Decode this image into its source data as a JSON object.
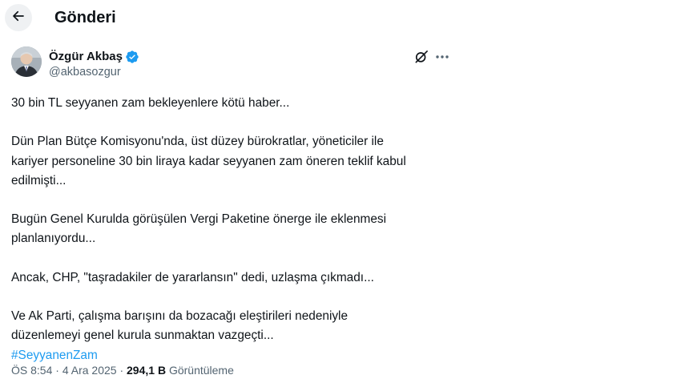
{
  "header": {
    "back_icon": "arrow-left-icon",
    "title": "Gönderi"
  },
  "author": {
    "name": "Özgür Akbaş",
    "handle": "@akbasozgur",
    "verified_color": "#1d9bf0",
    "icons": [
      "grok-icon",
      "more-icon"
    ]
  },
  "tweet": {
    "line_1": "30 bin TL seyyanen zam bekleyenlere kötü haber...",
    "para_2_line_1": "Dün Plan Bütçe Komisyonu'nda, üst düzey bürokratlar, yöneticiler ile",
    "para_2_line_2": "kariyer personeline 30 bin liraya kadar seyyanen zam öneren teklif kabul",
    "para_2_line_3": "edilmişti...",
    "para_3_line_1": "Bugün Genel Kurulda görüşülen Vergi Paketine önerge ile eklenmesi",
    "para_3_line_2": "planlanıyordu...",
    "para_4_line_1": "Ancak, CHP, \"taşradakiler de yararlansın\" dedi, uzlaşma çıkmadı...",
    "para_5_line_1": "Ve Ak Parti, çalışma barışını da bozacağı eleştirileri nedeniyle",
    "para_5_line_2": "düzenlemeyi genel kurula sunmaktan vazgeçti...",
    "hashtag": "#SeyyanenZam"
  },
  "meta": {
    "time": "ÖS 8:54",
    "separator": "·",
    "date": "4 Ara 2025",
    "views_count": "294,1 B",
    "views_label": "Görüntüleme"
  },
  "colors": {
    "text": "#0f1419",
    "secondary": "#536471",
    "link": "#1d9bf0"
  }
}
